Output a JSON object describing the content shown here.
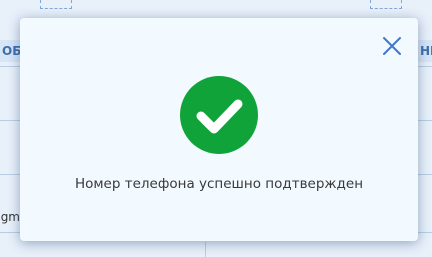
{
  "background": {
    "left_header_fragment": "ОБЩ",
    "right_header_fragment": "НИ",
    "left_cell_fragment": "gm"
  },
  "dialog": {
    "message": "Номер телефона успешно подтвержден",
    "close_icon": "close-icon",
    "status_icon": "check-circle-icon",
    "colors": {
      "success": "#10a33a",
      "close": "#3f78c8",
      "background": "#f2f9ff"
    }
  }
}
